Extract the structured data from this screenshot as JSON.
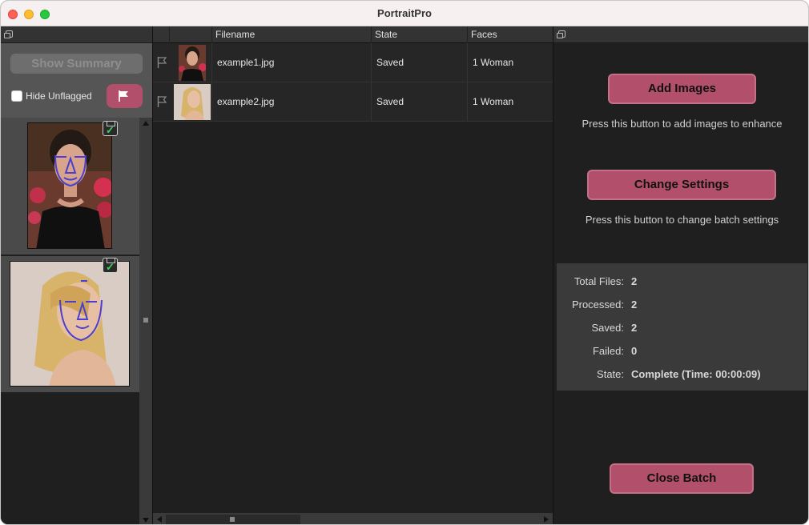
{
  "window": {
    "title": "PortraitPro"
  },
  "left_panel": {
    "show_summary_label": "Show Summary",
    "hide_unflagged_label": "Hide Unflagged",
    "hide_unflagged_checked": false
  },
  "table": {
    "columns": [
      "Filename",
      "State",
      "Faces"
    ],
    "rows": [
      {
        "filename": "example1.jpg",
        "state": "Saved",
        "faces": "1 Woman"
      },
      {
        "filename": "example2.jpg",
        "state": "Saved",
        "faces": "1 Woman"
      }
    ]
  },
  "right_panel": {
    "add_images_label": "Add Images",
    "add_images_hint": "Press this button to add images to enhance",
    "change_settings_label": "Change Settings",
    "change_settings_hint": "Press this button to change batch settings",
    "stats": {
      "total_files_label": "Total Files:",
      "total_files": "2",
      "processed_label": "Processed:",
      "processed": "2",
      "saved_label": "Saved:",
      "saved": "2",
      "failed_label": "Failed:",
      "failed": "0",
      "state_label": "State:",
      "state": "Complete (Time: 00:00:09)"
    },
    "close_batch_label": "Close Batch"
  },
  "icons": {
    "flag": "flag-icon",
    "dock": "dock-icon",
    "save_status": "save-status-icon",
    "check": "checkmark-icon"
  },
  "colors": {
    "accent": "#b2506b",
    "background": "#1f1f1f",
    "success": "#3bd65a"
  }
}
